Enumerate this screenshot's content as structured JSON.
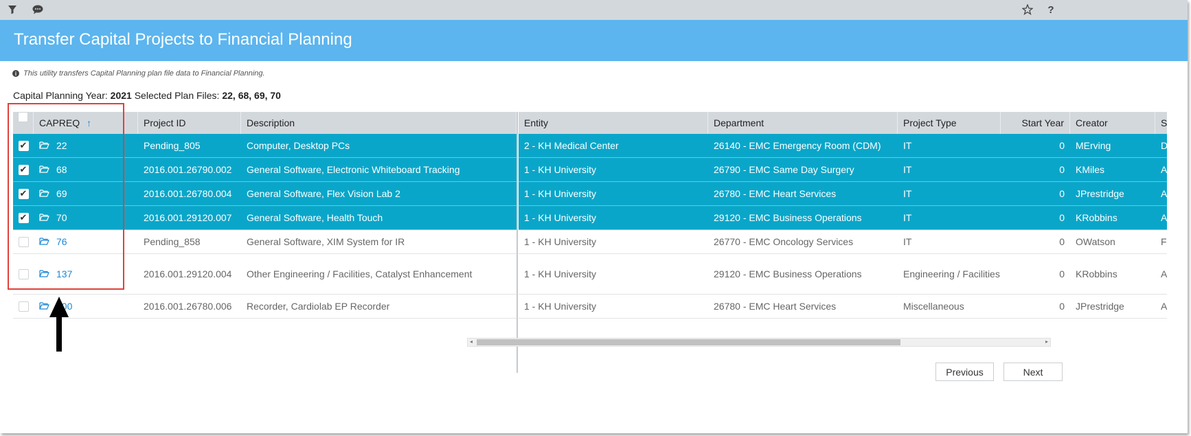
{
  "toolbar": {
    "icons": [
      "filter-icon",
      "comment-icon",
      "star-icon",
      "help-icon"
    ]
  },
  "title": "Transfer Capital Projects to Financial Planning",
  "info_text": "This utility transfers Capital Planning plan file data to Financial Planning.",
  "summary": {
    "year_label": "Capital Planning Year:",
    "year": "2021",
    "files_label": "Selected Plan Files:",
    "files": "22, 68, 69, 70"
  },
  "columns": {
    "capreq": "CAPREQ",
    "project_id": "Project ID",
    "description": "Description",
    "entity": "Entity",
    "department": "Department",
    "project_type": "Project Type",
    "start_year": "Start Year",
    "creator": "Creator",
    "next_partial": "S"
  },
  "rows": [
    {
      "selected": true,
      "capreq": "22",
      "project_id": "Pending_805",
      "description": "Computer, Desktop PCs",
      "entity": "2 - KH Medical Center",
      "department": "26140 - EMC Emergency Room (CDM)",
      "project_type": "IT",
      "start_year": "0",
      "creator": "MErving",
      "next": "D"
    },
    {
      "selected": true,
      "capreq": "68",
      "project_id": "2016.001.26790.002",
      "description": "General Software, Electronic Whiteboard Tracking",
      "entity": "1 - KH University",
      "department": "26790 - EMC Same Day Surgery",
      "project_type": "IT",
      "start_year": "0",
      "creator": "KMiles",
      "next": "A"
    },
    {
      "selected": true,
      "capreq": "69",
      "project_id": "2016.001.26780.004",
      "description": "General Software, Flex Vision Lab 2",
      "entity": "1 - KH University",
      "department": "26780 - EMC Heart Services",
      "project_type": "IT",
      "start_year": "0",
      "creator": "JPrestridge",
      "next": "A"
    },
    {
      "selected": true,
      "capreq": "70",
      "project_id": "2016.001.29120.007",
      "description": "General Software, Health Touch",
      "entity": "1 - KH University",
      "department": "29120 - EMC Business Operations",
      "project_type": "IT",
      "start_year": "0",
      "creator": "KRobbins",
      "next": "A"
    },
    {
      "selected": false,
      "capreq": "76",
      "project_id": "Pending_858",
      "description": "General Software, XIM System for IR",
      "entity": "1 - KH University",
      "department": "26770 - EMC Oncology Services",
      "project_type": "IT",
      "start_year": "0",
      "creator": "OWatson",
      "next": "F"
    },
    {
      "selected": false,
      "capreq": "137",
      "project_id": "2016.001.29120.004",
      "description": "Other Engineering / Facilities, Catalyst Enhancement",
      "entity": "1 - KH University",
      "department": "29120 - EMC Business Operations",
      "project_type": "Engineering / Facilities",
      "start_year": "0",
      "creator": "KRobbins",
      "next": "A"
    },
    {
      "selected": false,
      "capreq": "200",
      "project_id": "2016.001.26780.006",
      "description": "Recorder, Cardiolab EP Recorder",
      "entity": "1 - KH University",
      "department": "26780 - EMC Heart Services",
      "project_type": "Miscellaneous",
      "start_year": "0",
      "creator": "JPrestridge",
      "next": "A"
    }
  ],
  "buttons": {
    "previous": "Previous",
    "next": "Next"
  },
  "colors": {
    "title_bar": "#5cb5ee",
    "selected_row": "#0aa6c9",
    "highlight_box": "#e0413b"
  }
}
